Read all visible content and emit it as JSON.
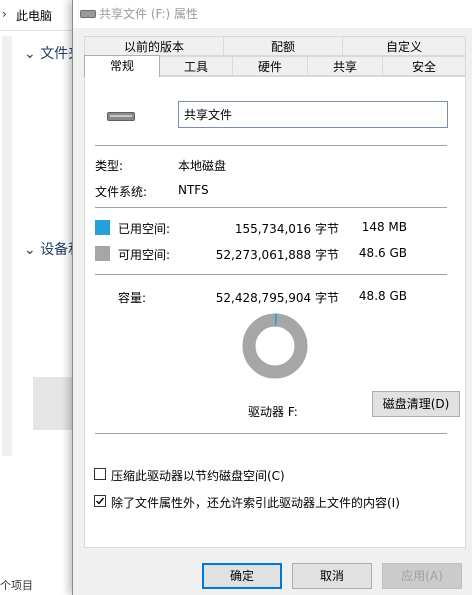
{
  "explorer": {
    "path": "此电脑",
    "section1": "文件夹",
    "section2": "设备和",
    "status": "个项目"
  },
  "dialog": {
    "title": "共享文件 (F:) 属性",
    "tabs_row1": [
      "以前的版本",
      "配额",
      "自定义"
    ],
    "tabs_row2": [
      "常规",
      "工具",
      "硬件",
      "共享",
      "安全"
    ],
    "active_tab": "常规",
    "name_value": "共享文件",
    "type_label": "类型:",
    "type_value": "本地磁盘",
    "fs_label": "文件系统:",
    "fs_value": "NTFS",
    "used": {
      "label": "已用空间:",
      "bytes": "155,734,016 字节",
      "size": "148 MB",
      "color": "#26a0da"
    },
    "free": {
      "label": "可用空间:",
      "bytes": "52,273,061,888 字节",
      "size": "48.6 GB",
      "color": "#a6a6a6"
    },
    "capacity": {
      "label": "容量:",
      "bytes": "52,428,795,904 字节",
      "size": "48.8 GB"
    },
    "used_fraction": 0.003,
    "drive_label": "驱动器 F:",
    "cleanup_button": "磁盘清理(D)",
    "compress_label": "压缩此驱动器以节约磁盘空间(C)",
    "compress_checked": false,
    "index_label": "除了文件属性外，还允许索引此驱动器上文件的内容(I)",
    "index_checked": true,
    "ok": "确定",
    "cancel": "取消",
    "apply": "应用(A)"
  }
}
